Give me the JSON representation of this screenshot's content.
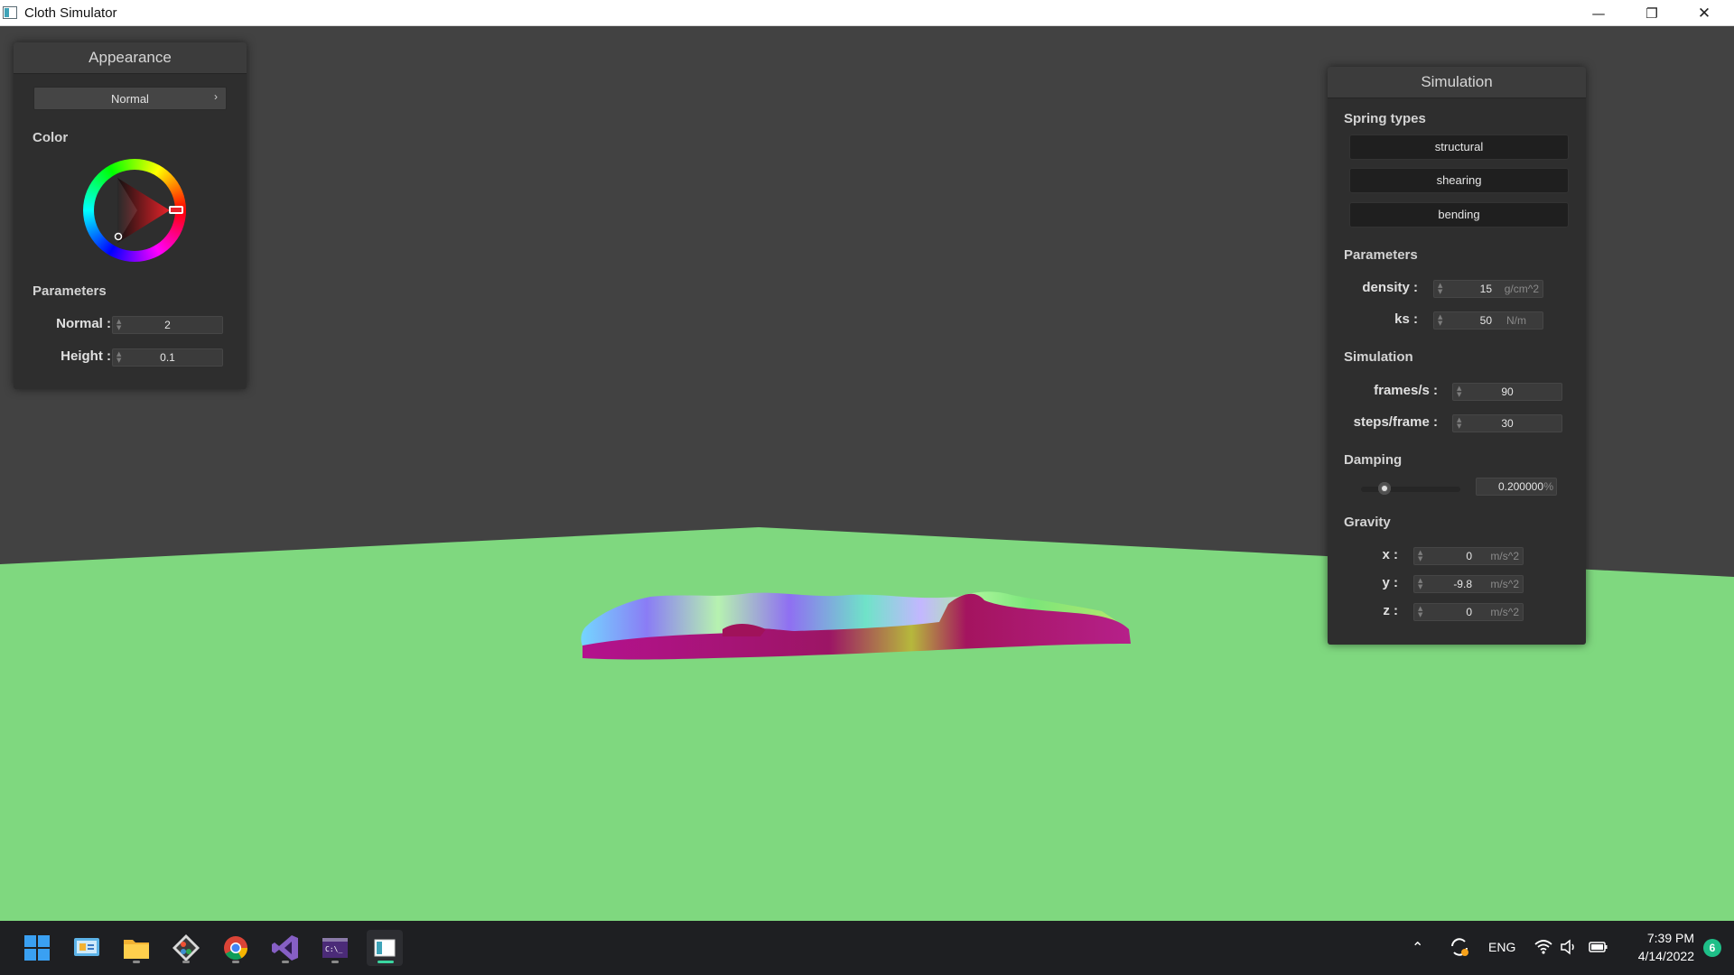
{
  "window": {
    "title": "Cloth Simulator",
    "controls": {
      "minimize": "—",
      "maximize": "❐",
      "close": "✕"
    }
  },
  "appearance": {
    "title": "Appearance",
    "render_mode": "Normal",
    "color_label": "Color",
    "selected_color": "#e8232a",
    "params_label": "Parameters",
    "normal_label": "Normal :",
    "normal_value": "2",
    "height_label": "Height :",
    "height_value": "0.1"
  },
  "simulation": {
    "title": "Simulation",
    "spring_types_label": "Spring types",
    "spring_types": [
      "structural",
      "shearing",
      "bending"
    ],
    "parameters_label": "Parameters",
    "density_label": "density :",
    "density_value": "15",
    "density_unit": "g/cm^2",
    "ks_label": "ks :",
    "ks_value": "50",
    "ks_unit": "N/m",
    "simulation_label": "Simulation",
    "fps_label": "frames/s :",
    "fps_value": "90",
    "steps_label": "steps/frame :",
    "steps_value": "30",
    "damping_label": "Damping",
    "damping_value": "0.200000",
    "damping_unit": "%",
    "damping_level": 0.2,
    "gravity_label": "Gravity",
    "gravity_x_label": "x :",
    "gravity_x_value": "0",
    "gravity_y_label": "y :",
    "gravity_y_value": "-9.8",
    "gravity_z_label": "z :",
    "gravity_z_value": "0",
    "gravity_unit": "m/s^2"
  },
  "scene": {
    "background_color": "#424242",
    "ground_color": "#7fd87f"
  },
  "taskbar": {
    "apps": [
      "start-icon",
      "control-panel-icon",
      "file-explorer-icon",
      "git-icon",
      "chrome-icon",
      "visual-studio-icon",
      "terminal-icon",
      "cloth-simulator-icon"
    ],
    "language": "ENG",
    "time": "7:39 PM",
    "date": "4/14/2022",
    "notification_count": "6"
  }
}
